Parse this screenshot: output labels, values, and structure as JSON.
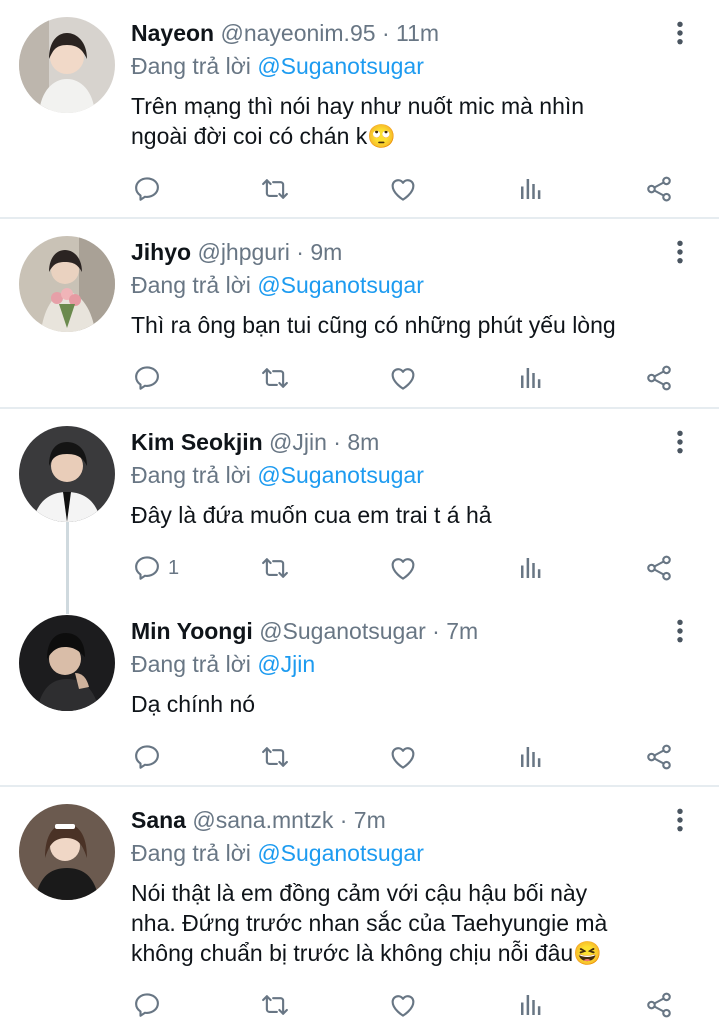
{
  "colors": {
    "accent": "#1d9bf0",
    "secondary": "#687684",
    "divider": "#e6ecf0"
  },
  "reply_prefix": "Đang trả lời",
  "tweets": [
    {
      "name": "Nayeon",
      "handle": "@nayeonim.95",
      "dot": "·",
      "time": "11m",
      "reply_to": "@Suganotsugar",
      "text_lines": [
        "Trên mạng thì nói hay như nuốt mic mà nhìn",
        "ngoài đời coi có chán k🙄"
      ],
      "reply_count": ""
    },
    {
      "name": "Jihyo",
      "handle": "@jhpguri",
      "dot": "·",
      "time": "9m",
      "reply_to": "@Suganotsugar",
      "text_lines": [
        "Thì ra ông bạn tui cũng có những phút yếu lòng"
      ],
      "reply_count": ""
    },
    {
      "name": "Kim Seokjin",
      "handle": "@Jjin",
      "dot": "·",
      "time": "8m",
      "reply_to": "@Suganotsugar",
      "text_lines": [
        "Đây là đứa muốn cua em trai t á hả"
      ],
      "reply_count": "1"
    },
    {
      "name": "Min Yoongi",
      "handle": "@Suganotsugar",
      "dot": "·",
      "time": "7m",
      "reply_to": "@Jjin",
      "text_lines": [
        "Dạ chính nó"
      ],
      "reply_count": ""
    },
    {
      "name": "Sana",
      "handle": "@sana.mntzk",
      "dot": "·",
      "time": "7m",
      "reply_to": "@Suganotsugar",
      "text_lines": [
        "Nói thật là em đồng cảm với cậu hậu bối này",
        "nha. Đứng trước nhan sắc của Taehyungie mà",
        "không chuẩn bị trước là không chịu nỗi đâu😆"
      ],
      "reply_count": ""
    }
  ],
  "icons": {
    "reply": "reply-icon",
    "retweet": "retweet-icon",
    "like": "heart-icon",
    "analytics": "analytics-icon",
    "share": "share-icon",
    "more": "more-vertical-icon"
  }
}
